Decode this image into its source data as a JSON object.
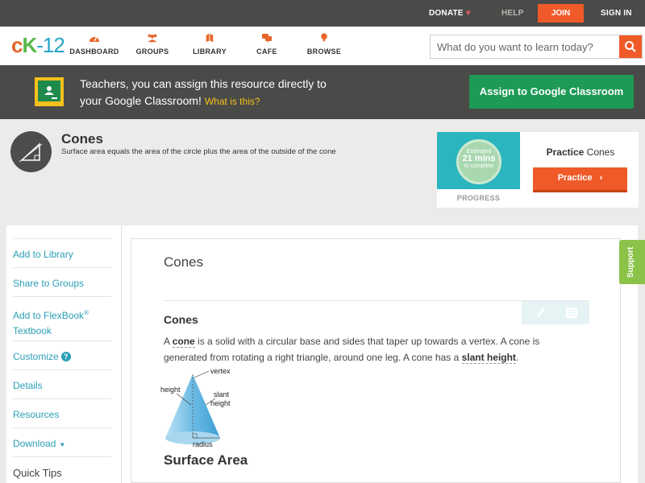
{
  "topbar": {
    "donate": "DONATE",
    "help": "HELP",
    "join": "JOIN",
    "signin": "SIGN IN"
  },
  "nav": {
    "logo": {
      "c": "c",
      "k": "K",
      "n": "-12"
    },
    "items": [
      {
        "label": "DASHBOARD",
        "icon": "dashboard-icon"
      },
      {
        "label": "GROUPS",
        "icon": "groups-icon"
      },
      {
        "label": "LIBRARY",
        "icon": "library-icon"
      },
      {
        "label": "CAFE",
        "icon": "cafe-icon"
      },
      {
        "label": "BROWSE",
        "icon": "browse-icon"
      }
    ],
    "search_placeholder": "What do you want to learn today?"
  },
  "banner": {
    "line1": "Teachers, you can assign this resource directly to",
    "line2": "your Google Classroom!",
    "what": "What is this?",
    "button": "Assign to Google Classroom"
  },
  "concept": {
    "title": "Cones",
    "subtitle": "Surface area equals the area of the circle plus the area of the outside of the cone"
  },
  "practice": {
    "estimated": "Estimated",
    "minutes": "21 mins",
    "complete": "to complete",
    "progress": "PROGRESS",
    "title_bold": "Practice",
    "title_rest": "Cones",
    "button": "Practice"
  },
  "sidebar": {
    "add_library": "Add to Library",
    "share_groups": "Share to Groups",
    "add_flexbook": "Add to FlexBook",
    "reg": "®",
    "textbook": "Textbook",
    "customize": "Customize",
    "customize_help": "?",
    "details": "Details",
    "resources": "Resources",
    "download": "Download",
    "download_caret": "▼",
    "quick_tips": "Quick Tips"
  },
  "main": {
    "title": "Cones",
    "section_title": "Cones",
    "p1_a": "A ",
    "p1_term1": "cone",
    "p1_b": " is a solid with a circular base and sides that taper up towards a vertex. A cone is generated from rotating a right triangle, around one leg. A cone has a ",
    "p1_term2": "slant height",
    "p1_c": ".",
    "diagram": {
      "vertex": "vertex",
      "height": "height",
      "slant1": "slant",
      "slant2": "height",
      "radius": "radius"
    },
    "section2_title": "Surface Area"
  },
  "support": "Support",
  "colors": {
    "accent": "#f05a28",
    "google_green": "#1d9a55",
    "link": "#2a9fb5",
    "support_green": "#8bc34a"
  }
}
